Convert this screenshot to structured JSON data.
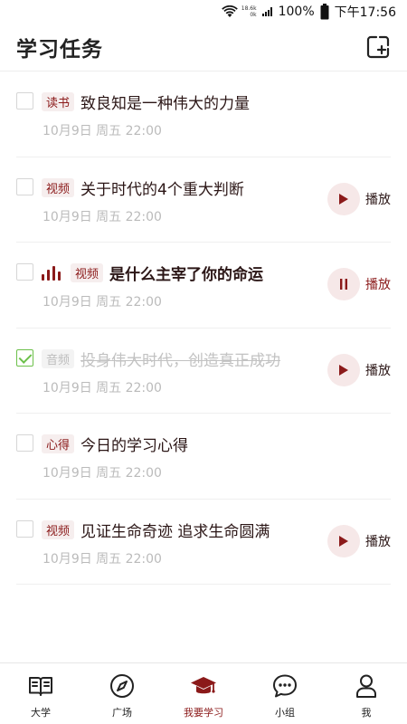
{
  "status_bar": {
    "net_speed_top": "18.6k",
    "net_speed_bottom": "0k",
    "battery": "100%",
    "time": "下午17:56"
  },
  "header": {
    "title": "学习任务",
    "add_icon": "edit-add-icon"
  },
  "tasks": [
    {
      "tag": "读书",
      "title": "致良知是一种伟大的力量",
      "meta": "10月9日 周五 22:00",
      "checked": false,
      "action": null
    },
    {
      "tag": "视频",
      "title": "关于时代的4个重大判断",
      "meta": "10月9日 周五 22:00",
      "checked": false,
      "action": "播放"
    },
    {
      "tag": "视频",
      "title": "是什么主宰了你的命运",
      "meta": "10月9日 周五 22:00",
      "checked": false,
      "action": "播放",
      "playing": true
    },
    {
      "tag": "音频",
      "title": "投身伟大时代，创造真正成功",
      "meta": "10月9日 周五 22:00",
      "checked": true,
      "action": "播放"
    },
    {
      "tag": "心得",
      "title": "今日的学习心得",
      "meta": "10月9日 周五 22:00",
      "checked": false,
      "action": null
    },
    {
      "tag": "视频",
      "title": "见证生命奇迹 追求生命圆满",
      "meta": "10月9日 周五 22:00",
      "checked": false,
      "action": "播放"
    }
  ],
  "tabbar": [
    {
      "label": "大学",
      "icon": "book-icon"
    },
    {
      "label": "广场",
      "icon": "compass-icon"
    },
    {
      "label": "我要学习",
      "icon": "graduation-cap-icon",
      "active": true
    },
    {
      "label": "小组",
      "icon": "chat-bubble-icon"
    },
    {
      "label": "我",
      "icon": "user-icon"
    }
  ],
  "colors": {
    "accent": "#8b1a1a",
    "check_green": "#6cc04a"
  }
}
